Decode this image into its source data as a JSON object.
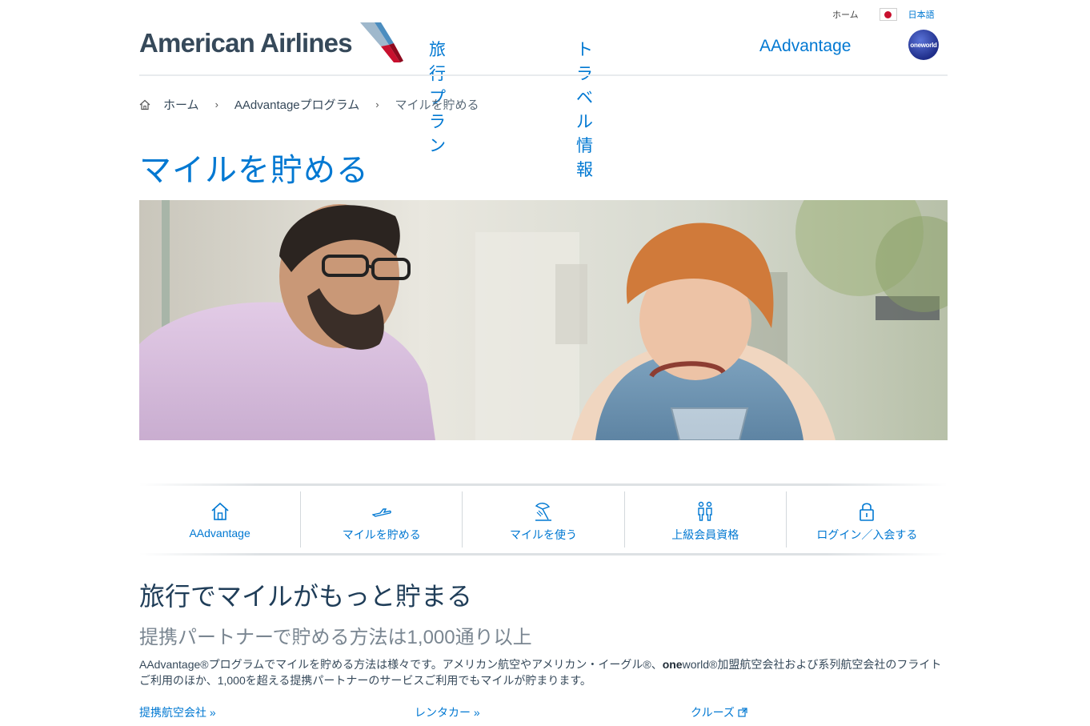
{
  "brand": {
    "name": "American Airlines",
    "primary_color": "#0078d2",
    "text_color": "#36495a",
    "accent_red": "#c8102e"
  },
  "utility": {
    "home": "ホーム",
    "language": "日本語"
  },
  "nav": {
    "items": [
      "旅行プラン",
      "トラベル情報",
      "AAdvantage"
    ],
    "alliance": "oneworld"
  },
  "breadcrumb": {
    "home": "ホーム",
    "level1": "AAdvantageプログラム",
    "current": "マイルを貯める",
    "separator": "›"
  },
  "page": {
    "title": "マイルを貯める"
  },
  "hero": {
    "description_icon": "hero-photo"
  },
  "icon_nav": [
    {
      "label": "AAdvantage",
      "icon": "home-icon"
    },
    {
      "label": "マイルを貯める",
      "icon": "plane-icon"
    },
    {
      "label": "マイルを使う",
      "icon": "beach-icon"
    },
    {
      "label": "上級会員資格",
      "icon": "people-icon"
    },
    {
      "label": "ログイン／入会する",
      "icon": "lock-icon"
    }
  ],
  "section": {
    "title": "旅行でマイルがもっと貯まる",
    "subtitle": "提携パートナーで貯める方法は1,000通り以上",
    "body_pre": "AAdvantage®プログラムでマイルを貯める方法は様々です。アメリカン航空やアメリカン・イーグル®、",
    "body_bold": "one",
    "body_post": "world®加盟航空会社および系列航空会社のフライトご利用のほか、1,000を超える提携パートナーのサービスご利用でもマイルが貯まります。"
  },
  "links": [
    "提携航空会社 »",
    "レンタカー »",
    "クルーズ"
  ]
}
